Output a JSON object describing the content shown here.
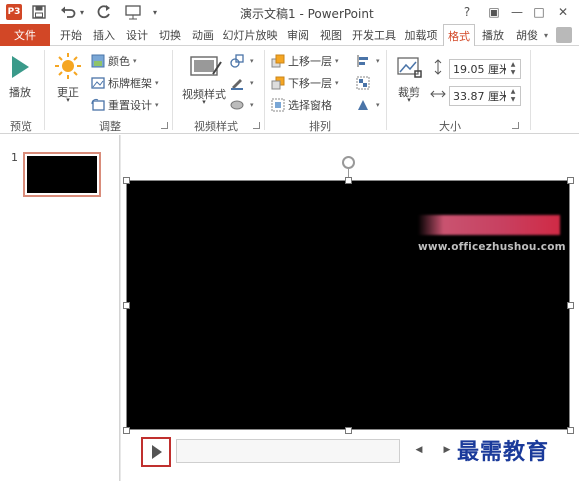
{
  "app": {
    "title": "演示文稿1 - PowerPoint",
    "logo_text": "P3"
  },
  "window_controls": [
    "?",
    "▣",
    "—",
    "□",
    "✕"
  ],
  "tabs": {
    "file": "文件",
    "items": [
      "开始",
      "插入",
      "设计",
      "切换",
      "动画",
      "幻灯片放映",
      "审阅",
      "视图",
      "开发工具",
      "加载项",
      "格式",
      "播放"
    ],
    "active": "格式",
    "user": "胡俊"
  },
  "ribbon": {
    "preview": {
      "play_label": "播放",
      "group_label": "预览"
    },
    "adjust": {
      "correct_label": "更正",
      "color_label": "颜色",
      "poster_frame_label": "标牌框架",
      "reset_design_label": "重置设计",
      "group_label": "调整"
    },
    "video_styles": {
      "video_style_label": "视频样式",
      "group_label": "视频样式"
    },
    "arrange": {
      "bring_forward_label": "上移一层",
      "send_backward_label": "下移一层",
      "selection_pane_label": "选择窗格",
      "group_label": "排列"
    },
    "size": {
      "crop_label": "裁剪",
      "height_value": "19.05 厘米",
      "width_value": "33.87 厘米",
      "group_label": "大小"
    }
  },
  "slides": {
    "number": "1"
  },
  "watermark_text": "www.officezhushou.com",
  "brand_text": "最需教育",
  "colors": {
    "accent": "#d24726",
    "play_highlight": "#c0302e",
    "brand": "#1a3a9a"
  },
  "icons": [
    "save-icon",
    "undo-icon",
    "redo-icon",
    "present-icon",
    "play-icon",
    "sun-icon",
    "palette-icon",
    "rewind-icon",
    "forward-icon",
    "volume-icon"
  ]
}
